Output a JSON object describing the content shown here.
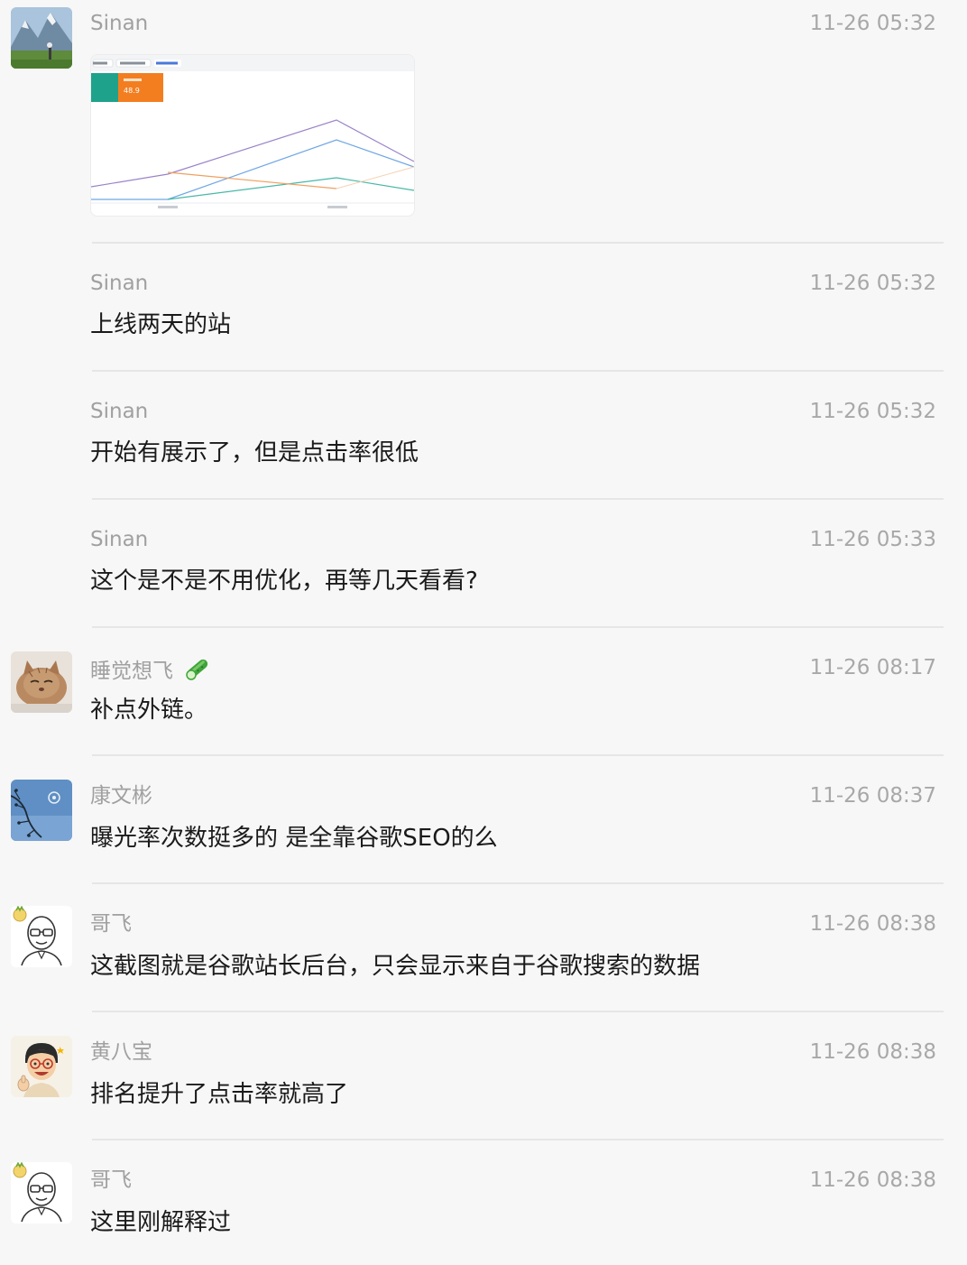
{
  "messages": [
    {
      "sender": "Sinan",
      "time": "11-26 05:32",
      "text": "",
      "avatar": "mountain-landscape-avatar",
      "attachment": {
        "type": "image",
        "kpi_value": "48.9",
        "tabs": [
          "网络",
          "查看数据资料",
          "查看自定资料"
        ]
      }
    },
    {
      "sender": "Sinan",
      "time": "11-26 05:32",
      "text": "上线两天的站"
    },
    {
      "sender": "Sinan",
      "time": "11-26 05:32",
      "text": "开始有展示了，但是点击率很低"
    },
    {
      "sender": "Sinan",
      "time": "11-26 05:33",
      "text": "这个是不是不用优化，再等几天看看?"
    },
    {
      "sender": "睡觉想飞",
      "time": "11-26 08:17",
      "text": "补点外链。",
      "avatar": "cat-avatar",
      "badge": "cucumber-icon"
    },
    {
      "sender": "康文彬",
      "time": "11-26 08:37",
      "text": "曝光率次数挺多的  是全靠谷歌SEO的么",
      "avatar": "blue-sky-branch-avatar"
    },
    {
      "sender": "哥飞",
      "time": "11-26 08:38",
      "text": "这截图就是谷歌站长后台，只会显示来自于谷歌搜索的数据",
      "avatar": "bald-glasses-cartoon-avatar"
    },
    {
      "sender": "黄八宝",
      "time": "11-26 08:38",
      "text": "排名提升了点击率就高了",
      "avatar": "glasses-thumbs-up-cartoon-avatar"
    },
    {
      "sender": "哥飞",
      "time": "11-26 08:38",
      "text": "这里刚解释过",
      "avatar": "bald-glasses-cartoon-avatar"
    }
  ],
  "colors": {
    "background": "#f7f7f7",
    "name": "#a0a0a0",
    "time": "#a8a8a8",
    "text": "#1a1a1a",
    "divider": "#e6e6e6",
    "kpi_orange": "#f37e20",
    "kpi_teal": "#1ea28b"
  }
}
